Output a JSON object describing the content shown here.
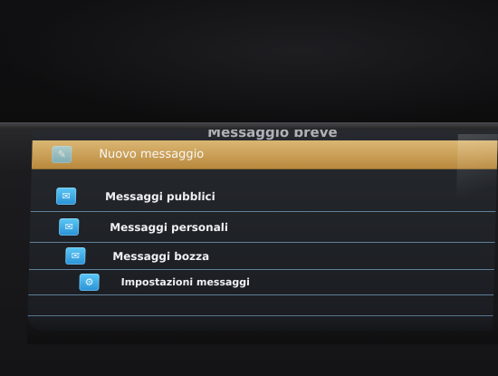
{
  "screen": {
    "title": "Messaggio breve"
  },
  "menu": {
    "items": [
      {
        "label": "Nuovo messaggio",
        "icon": "new-message-icon",
        "selected": true
      },
      {
        "label": "Messaggi pubblici",
        "icon": "public-messages-icon",
        "selected": false
      },
      {
        "label": "Messaggi personali",
        "icon": "personal-messages-icon",
        "selected": false
      },
      {
        "label": "Messaggi bozza",
        "icon": "draft-messages-icon",
        "selected": false
      },
      {
        "label": "Impostazioni messaggi",
        "icon": "message-settings-icon",
        "selected": false
      }
    ]
  },
  "colors": {
    "selected_row": "#cda25a",
    "row_divider": "#5f7f99",
    "icon_blue": "#2a92d6",
    "screen_bg": "#1e2126"
  }
}
